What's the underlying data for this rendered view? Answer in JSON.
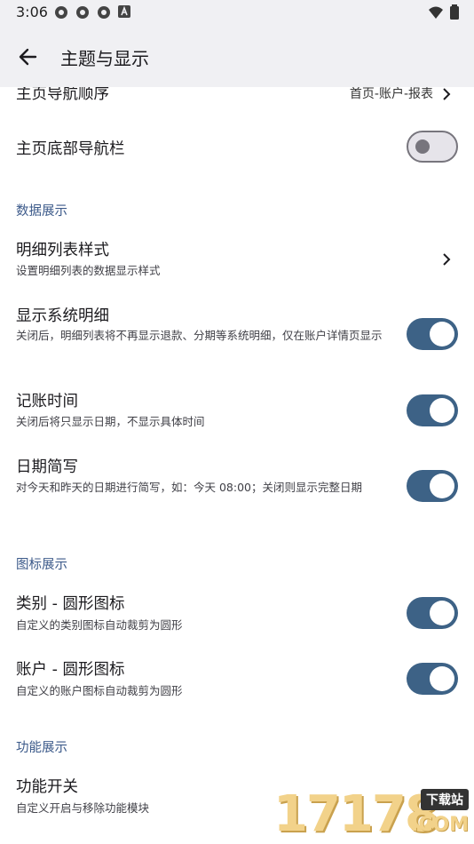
{
  "status_bar": {
    "time": "3:06",
    "left_icons": [
      "gear-icon",
      "gear-icon",
      "gear-icon",
      "a-badge-icon"
    ],
    "right_icons": [
      "wifi-icon",
      "battery-icon"
    ]
  },
  "app_bar": {
    "title": "主题与显示",
    "back_icon": "arrow-back-icon"
  },
  "rows": {
    "home_nav_order": {
      "title": "主页导航顺序",
      "value": "首页-账户-报表"
    },
    "home_bottom_nav": {
      "title": "主页底部导航栏",
      "switch": "off"
    },
    "section_data": "数据展示",
    "detail_list_style": {
      "title": "明细列表样式",
      "subtitle": "设置明细列表的数据显示样式"
    },
    "show_system_detail": {
      "title": "显示系统明细",
      "subtitle": "关闭后，明细列表将不再显示退款、分期等系统明细，仅在账户详情页显示",
      "switch": "on"
    },
    "record_time": {
      "title": "记账时间",
      "subtitle": "关闭后将只显示日期，不显示具体时间",
      "switch": "on"
    },
    "date_short": {
      "title": "日期简写",
      "subtitle": "对今天和昨天的日期进行简写，如：今天 08:00；关闭则显示完整日期",
      "switch": "on"
    },
    "section_icons": "图标展示",
    "category_round": {
      "title": "类别 - 圆形图标",
      "subtitle": "自定义的类别图标自动裁剪为圆形",
      "switch": "on"
    },
    "account_round": {
      "title": "账户 - 圆形图标",
      "subtitle": "自定义的账户图标自动裁剪为圆形",
      "switch": "on"
    },
    "section_features": "功能展示",
    "feature_switch": {
      "title": "功能开关",
      "subtitle": "自定义开启与移除功能模块"
    }
  },
  "watermark": {
    "digits": "17178",
    "badge": "下载站",
    "suffix": ".COM"
  },
  "colors": {
    "switch_on": "#3d6286",
    "section_head": "#3c5a8a",
    "bar_bg": "#f0f0f3"
  }
}
